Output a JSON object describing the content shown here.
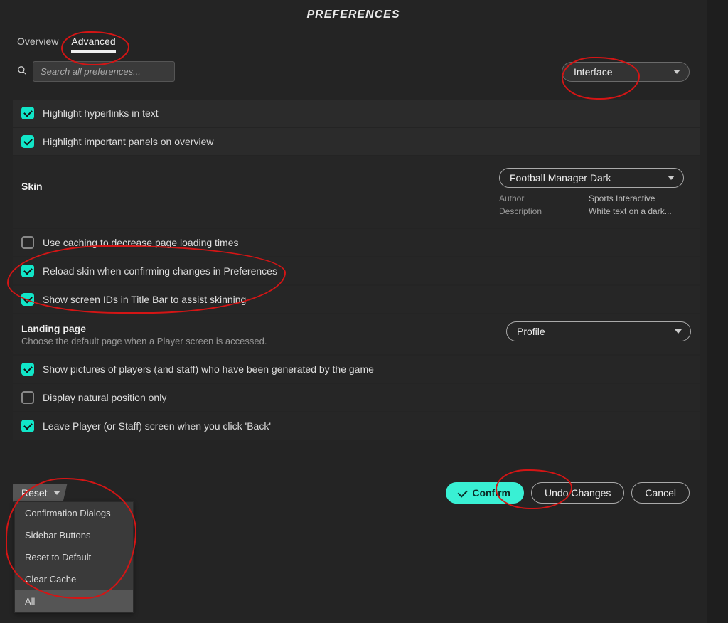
{
  "title": "PREFERENCES",
  "tabs": {
    "overview": "Overview",
    "advanced": "Advanced"
  },
  "search": {
    "placeholder": "Search all preferences..."
  },
  "category": {
    "selected": "Interface"
  },
  "rows": {
    "hyperlinks": "Highlight hyperlinks in text",
    "panels": "Highlight important panels on overview",
    "caching": "Use caching to decrease page loading times",
    "reload": "Reload skin when confirming changes in Preferences",
    "screenids": "Show screen IDs in Title Bar to assist skinning",
    "pictures": "Show pictures of players (and staff) who have been generated by the game",
    "natural": "Display natural position only",
    "back": "Leave Player (or Staff) screen when you click 'Back'"
  },
  "skin": {
    "label": "Skin",
    "selected": "Football Manager Dark",
    "author_label": "Author",
    "author": "Sports Interactive",
    "desc_label": "Description",
    "desc": "White text on a dark..."
  },
  "landing": {
    "header": "Landing page",
    "sub": "Choose the default page when a Player screen is accessed.",
    "selected": "Profile"
  },
  "footer": {
    "reset": "Reset",
    "confirm": "Confirm",
    "undo": "Undo Changes",
    "cancel": "Cancel"
  },
  "reset_menu": {
    "i0": "Confirmation Dialogs",
    "i1": "Sidebar Buttons",
    "i2": "Reset to Default",
    "i3": "Clear Cache",
    "i4": "All"
  }
}
